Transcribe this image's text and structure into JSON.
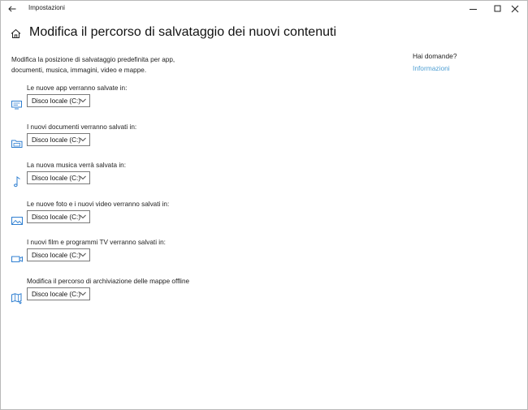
{
  "window": {
    "title": "Impostazioni"
  },
  "page": {
    "title": "Modifica il percorso di salvataggio dei nuovi contenuti",
    "intro": "Modifica la posizione di salvataggio predefinita per app, documenti, musica, immagini, video e mappe."
  },
  "aside": {
    "question": "Hai domande?",
    "link": "Informazioni"
  },
  "settings": [
    {
      "label": "Le nuove app verranno salvate in:",
      "value": "Disco locale (C:)",
      "icon": "monitor-icon"
    },
    {
      "label": "I nuovi documenti verranno salvati in:",
      "value": "Disco locale (C:)",
      "icon": "folder-icon"
    },
    {
      "label": "La nuova musica verrà salvata in:",
      "value": "Disco locale (C:)",
      "icon": "music-note-icon"
    },
    {
      "label": "Le nuove foto e i nuovi video verranno salvati in:",
      "value": "Disco locale (C:)",
      "icon": "photo-icon"
    },
    {
      "label": "I nuovi film e programmi TV verranno salvati in:",
      "value": "Disco locale (C:)",
      "icon": "video-camera-icon"
    },
    {
      "label": "Modifica il percorso di archiviazione delle mappe offline",
      "value": "Disco locale (C:)",
      "icon": "map-icon"
    }
  ],
  "colors": {
    "accent": "#4f9fd3",
    "icon_blue": "#2f7fd1"
  }
}
